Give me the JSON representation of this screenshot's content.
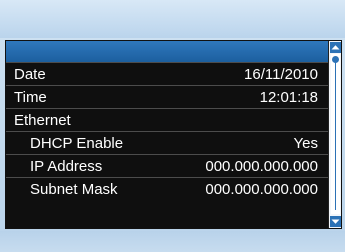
{
  "settings_list": {
    "rows": [
      {
        "label": "Date",
        "value": "16/11/2010"
      },
      {
        "label": "Time",
        "value": "12:01:18"
      },
      {
        "label": "Ethernet",
        "value": ""
      },
      {
        "label": "DHCP Enable",
        "value": "Yes"
      },
      {
        "label": "IP Address",
        "value": "000.000.000.000"
      },
      {
        "label": "Subnet Mask",
        "value": "000.000.000.000"
      }
    ]
  },
  "scrollbar": {
    "up_icon": "triangle-up-icon",
    "down_icon": "triangle-down-icon"
  },
  "colors": {
    "header_blue": "#1c5f9f",
    "row_background": "#0f0f0f",
    "screen_light_blue": "#c7dcef",
    "scroll_blue": "#2c72b6"
  }
}
